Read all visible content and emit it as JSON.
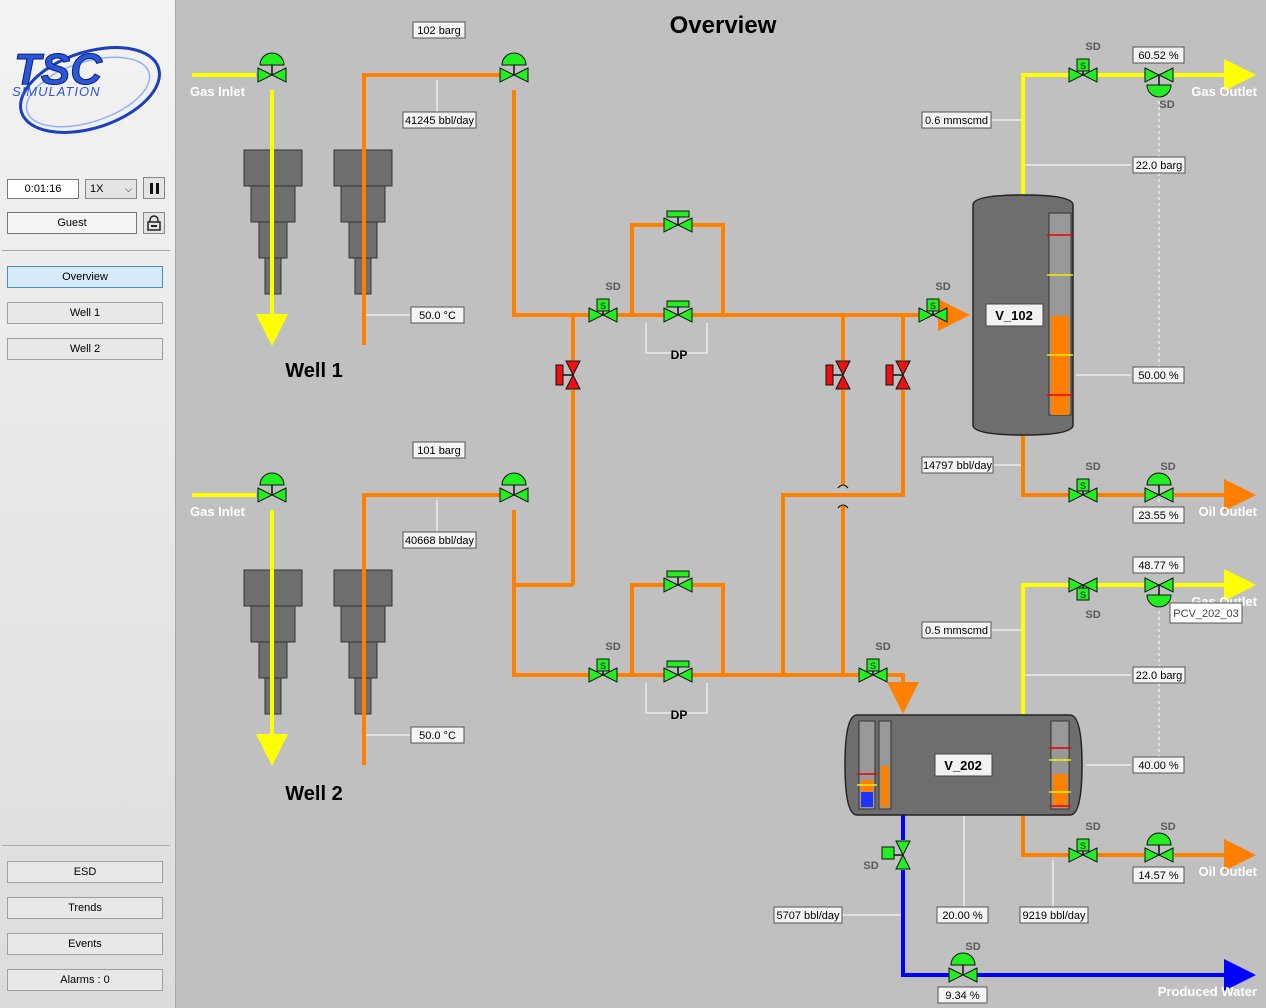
{
  "sidebar": {
    "logo_line1": "TSC",
    "logo_line2": "SIMULATION",
    "time": "0:01:16",
    "speed": "1X",
    "user": "Guest",
    "nav": [
      {
        "label": "Overview",
        "active": true
      },
      {
        "label": "Well 1"
      },
      {
        "label": "Well 2"
      }
    ],
    "bottom": [
      "ESD",
      "Trends",
      "Events",
      "Alarms : 0"
    ]
  },
  "title": "Overview",
  "wells": [
    {
      "name": "Well 1",
      "gas_inlet": "Gas Inlet",
      "pressure": "102 barg",
      "flow": "41245 bbl/day",
      "temp": "50.0 °C"
    },
    {
      "name": "Well 2",
      "gas_inlet": "Gas Inlet",
      "pressure": "101 barg",
      "flow": "40668 bbl/day",
      "temp": "50.0 °C"
    }
  ],
  "dp_labels": [
    "DP",
    "DP"
  ],
  "sd_label": "SD",
  "v102": {
    "name": "V_102",
    "gas_flow": "0.6 mmscmd",
    "gas_valve": "60.52 %",
    "pressure": "22.0 barg",
    "level": "50.00 %",
    "level_fill": 0.5,
    "oil_flow": "14797 bbl/day",
    "oil_valve": "23.55 %",
    "gas_outlet": "Gas Outlet",
    "oil_outlet": "Oil Outlet"
  },
  "v202": {
    "name": "V_202",
    "gas_flow": "0.5 mmscmd",
    "gas_valve": "48.77 %",
    "tooltip": "PCV_202_03",
    "pressure": "22.0 barg",
    "level": "40.00 %",
    "oil_flow": "9219 bbl/day",
    "oil_valve": "14.57 %",
    "water_flow": "5707 bbl/day",
    "water_level": "20.00 %",
    "water_valve": "9.34 %",
    "gas_outlet": "Gas Outlet",
    "oil_outlet": "Oil Outlet",
    "water_outlet": "Produced Water"
  },
  "colors": {
    "oil": "#ff8000",
    "gas": "#ffff00",
    "water": "#0000ff",
    "valve_ok": "#22ee22",
    "valve_closed": "#ee1111"
  }
}
